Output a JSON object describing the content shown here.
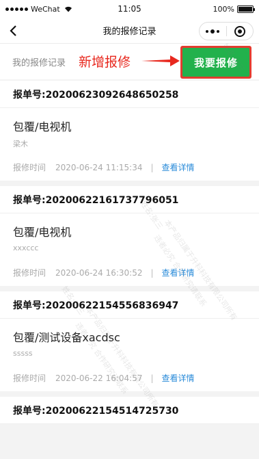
{
  "status_bar": {
    "carrier": "WeChat",
    "time": "11:05",
    "battery": "100%",
    "battery_level": 1.0
  },
  "nav": {
    "title": "我的报修记录",
    "back_icon": "chevron-left-icon",
    "more_icon": "more-dots-icon",
    "close_icon": "target-close-icon"
  },
  "header": {
    "label": "我的报修记录",
    "annotation": "新增报修",
    "repair_button": "我要报修",
    "colors": {
      "annotation": "#e8281e",
      "button": "#22b14c",
      "button_outline": "#e33c2f"
    }
  },
  "orders": [
    {
      "order_no": "报单号:20200623092648650258",
      "device": "包覆/电视机",
      "person": "梁木",
      "time_label": "报修时间",
      "time": "2020-06-24 11:15:34",
      "detail": "查看详情"
    },
    {
      "order_no": "报单号:20200622161737796051",
      "device": "包覆/电视机",
      "person": "xxxccc",
      "time_label": "报修时间",
      "time": "2020-06-24 16:30:52",
      "detail": "查看详情"
    },
    {
      "order_no": "报单号:20200622154556836947",
      "device": "包覆/测试设备xacdsc",
      "person": "sssss",
      "time_label": "报修时间",
      "time": "2020-06-22 16:04:57",
      "detail": "查看详情"
    },
    {
      "order_no": "报单号:20200622154514725730"
    }
  ],
  "watermark": [
    "本产品归属于升科科技有限公司所有",
    "违者必究 合作研究请联系",
    "姓名:张三"
  ]
}
